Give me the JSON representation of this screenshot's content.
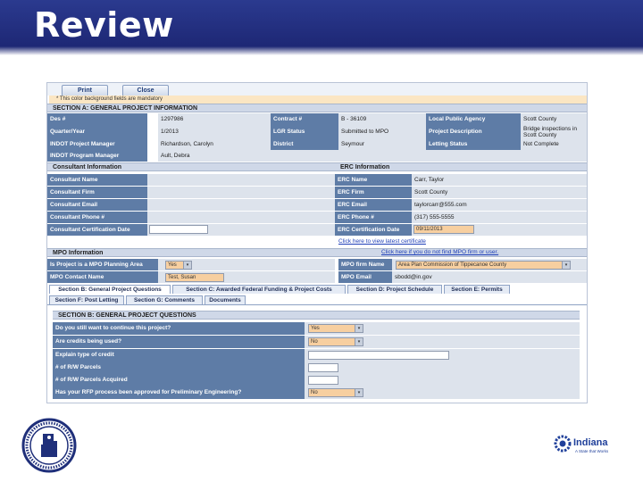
{
  "slide": {
    "title": "Review"
  },
  "toolbar": {
    "print": "Print",
    "close": "Close"
  },
  "mandatory_note": "* This color background fields are mandatory",
  "section_a": {
    "header": "SECTION A: GENERAL PROJECT INFORMATION",
    "fields": [
      {
        "label": "Des #",
        "value": "1297986"
      },
      {
        "label": "Contract #",
        "value": "B - 36109"
      },
      {
        "label": "Local Public Agency",
        "value": "Scott County"
      },
      {
        "label": "Quarter/Year",
        "value": "1/2013"
      },
      {
        "label": "LGR Status",
        "value": "Submitted to MPO"
      },
      {
        "label": "Project Description",
        "value": "Bridge inspections in Scott County"
      },
      {
        "label": "INDOT Project Manager",
        "value": "Richardson, Carolyn"
      },
      {
        "label": "District",
        "value": "Seymour"
      },
      {
        "label": "Letting Status",
        "value": "Not Complete"
      },
      {
        "label": "INDOT Program Manager",
        "value": "Ault, Debra"
      }
    ]
  },
  "consultant": {
    "header": "Consultant Information",
    "fields": [
      {
        "label": "Consultant Name",
        "value": ""
      },
      {
        "label": "Consultant Firm",
        "value": ""
      },
      {
        "label": "Consultant Email",
        "value": ""
      },
      {
        "label": "Consultant Phone #",
        "value": ""
      },
      {
        "label": "Consultant Certification Date",
        "value": ""
      }
    ]
  },
  "erc": {
    "header": "ERC Information",
    "fields": [
      {
        "label": "ERC Name",
        "value": "Carr, Taylor"
      },
      {
        "label": "ERC Firm",
        "value": "Scott County"
      },
      {
        "label": "ERC Email",
        "value": "taylorcarr@555.com"
      },
      {
        "label": "ERC Phone #",
        "value": "(317) 555-5555"
      },
      {
        "label": "ERC Certification Date",
        "value": "09/11/2013"
      }
    ],
    "cert_link": "Click here to view latest certificate"
  },
  "mpo": {
    "header": "MPO Information",
    "help_link": "Click here if you do not find MPO firm or user.",
    "planning_label": "Is Project is a MPO Planning Area",
    "planning_value": "Yes",
    "contact_label": "MPO Contact Name",
    "contact_value": "Test, Susan",
    "firm_label": "MPO firm Name",
    "firm_value": "Area Plan Commission of Tippecanoe County",
    "email_label": "MPO Email",
    "email_value": "sbodd@in.gov"
  },
  "tabs": [
    {
      "label": "Section B: General Project Questions"
    },
    {
      "label": "Section C: Awarded Federal Funding & Project Costs"
    },
    {
      "label": "Section D: Project Schedule"
    },
    {
      "label": "Section E: Permits"
    },
    {
      "label": "Section F: Post Letting"
    },
    {
      "label": "Section G: Comments"
    },
    {
      "label": "Documents"
    }
  ],
  "section_b": {
    "header": "SECTION B: GENERAL PROJECT QUESTIONS",
    "questions": [
      {
        "label": "Do you still want to continue this project?",
        "value": "Yes"
      },
      {
        "label": "Are credits being used?",
        "value": "No"
      },
      {
        "label": "Explain type of credit",
        "value": ""
      },
      {
        "label": "# of R/W Parcels",
        "value": ""
      },
      {
        "label": "# of R/W Parcels Acquired",
        "value": ""
      },
      {
        "label": "Has your RFP process been approved for Preliminary Engineering?",
        "value": "No"
      }
    ]
  },
  "logos": {
    "right_name": "Indiana",
    "right_tagline": "A State that Works"
  }
}
